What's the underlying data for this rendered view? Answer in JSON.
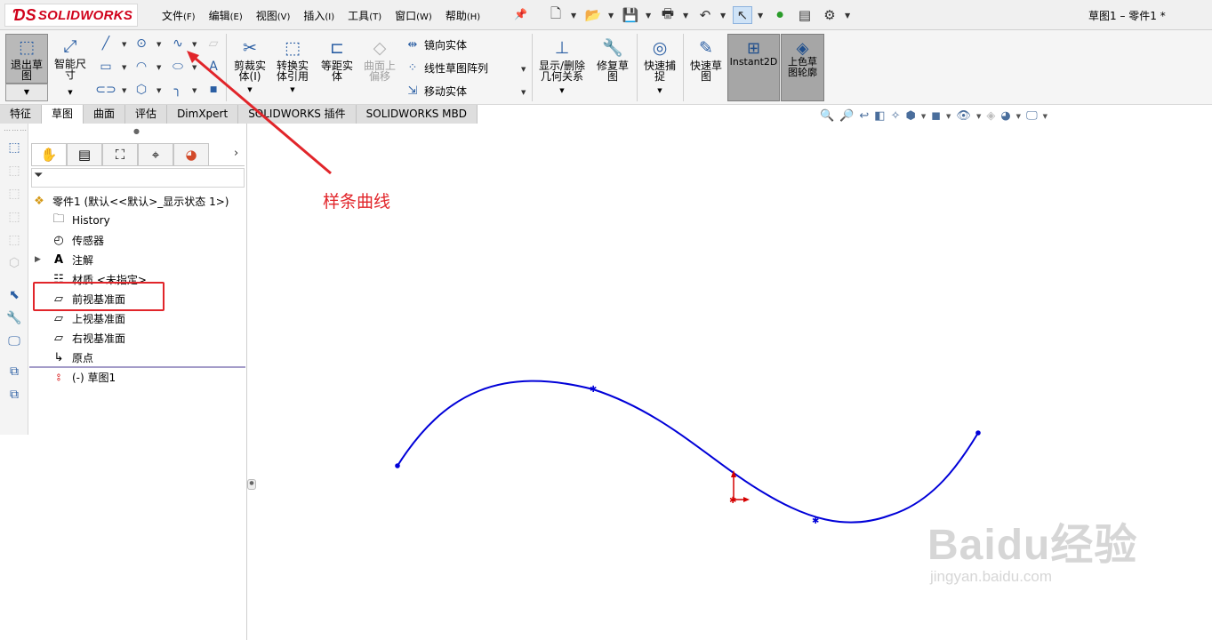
{
  "app": {
    "logo_text": "SOLIDWORKS",
    "doc_title": "草图1 – 零件1 *"
  },
  "menu": [
    {
      "label": "文件",
      "key": "(F)"
    },
    {
      "label": "编辑",
      "key": "(E)"
    },
    {
      "label": "视图",
      "key": "(V)"
    },
    {
      "label": "插入",
      "key": "(I)"
    },
    {
      "label": "工具",
      "key": "(T)"
    },
    {
      "label": "窗口",
      "key": "(W)"
    },
    {
      "label": "帮助",
      "key": "(H)"
    }
  ],
  "toolbar": {
    "exit_sketch": "退出草图",
    "smart_dim": "智能尺寸",
    "trim": "剪裁实体(I)",
    "convert": "转换实体引用",
    "offset": "等距实体",
    "surface_offset": "曲面上偏移",
    "mirror": "镜向实体",
    "linear_pattern": "线性草图阵列",
    "move": "移动实体",
    "display_relations": "显示/删除几何关系",
    "repair": "修复草图",
    "quick_snap": "快速捕捉",
    "rapid_sketch": "快速草图",
    "instant2d": "Instant2D",
    "shaded_contour": "上色草图轮廓"
  },
  "tabs": [
    "特征",
    "草图",
    "曲面",
    "评估",
    "DimXpert",
    "SOLIDWORKS 插件",
    "SOLIDWORKS MBD"
  ],
  "active_tab": "草图",
  "tree": {
    "root": "零件1  (默认<<默认>_显示状态 1>)",
    "history": "History",
    "sensors": "传感器",
    "annotations": "注解",
    "material": "材质 <未指定>",
    "front_plane": "前视基准面",
    "top_plane": "上视基准面",
    "right_plane": "右视基准面",
    "origin": "原点",
    "sketch": "(-) 草图1"
  },
  "annotation": {
    "text": "样条曲线",
    "color": "#e1252a"
  },
  "colors": {
    "spline": "#0000d8",
    "origin": "#d40000",
    "highlight": "#e1252a"
  },
  "watermark": {
    "brand": "Baidu经验",
    "url": "jingyan.baidu.com"
  }
}
